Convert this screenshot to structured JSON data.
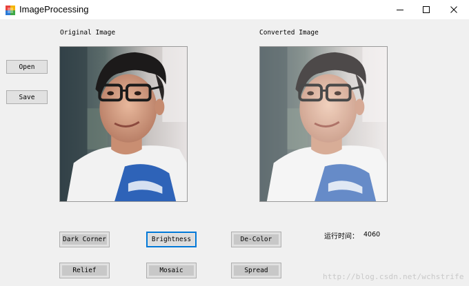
{
  "window": {
    "title": "ImageProcessing",
    "controls": [
      "minimize",
      "maximize",
      "close"
    ]
  },
  "labels": {
    "original": "Original Image",
    "converted": "Converted Image"
  },
  "side_buttons": {
    "open": "Open",
    "save": "Save"
  },
  "operations": [
    {
      "label": "Dark Corner"
    },
    {
      "label": "Brightness",
      "focused": true
    },
    {
      "label": "De-Color"
    },
    {
      "label": "Relief"
    },
    {
      "label": "Mosaic"
    },
    {
      "label": "Spread"
    }
  ],
  "runtime": {
    "label": "运行时间：",
    "value": "4060"
  },
  "watermark": "http://blog.csdn.net/wchstrife",
  "images": {
    "original_icon": "portrait-photo",
    "converted_icon": "portrait-photo-brightened"
  }
}
